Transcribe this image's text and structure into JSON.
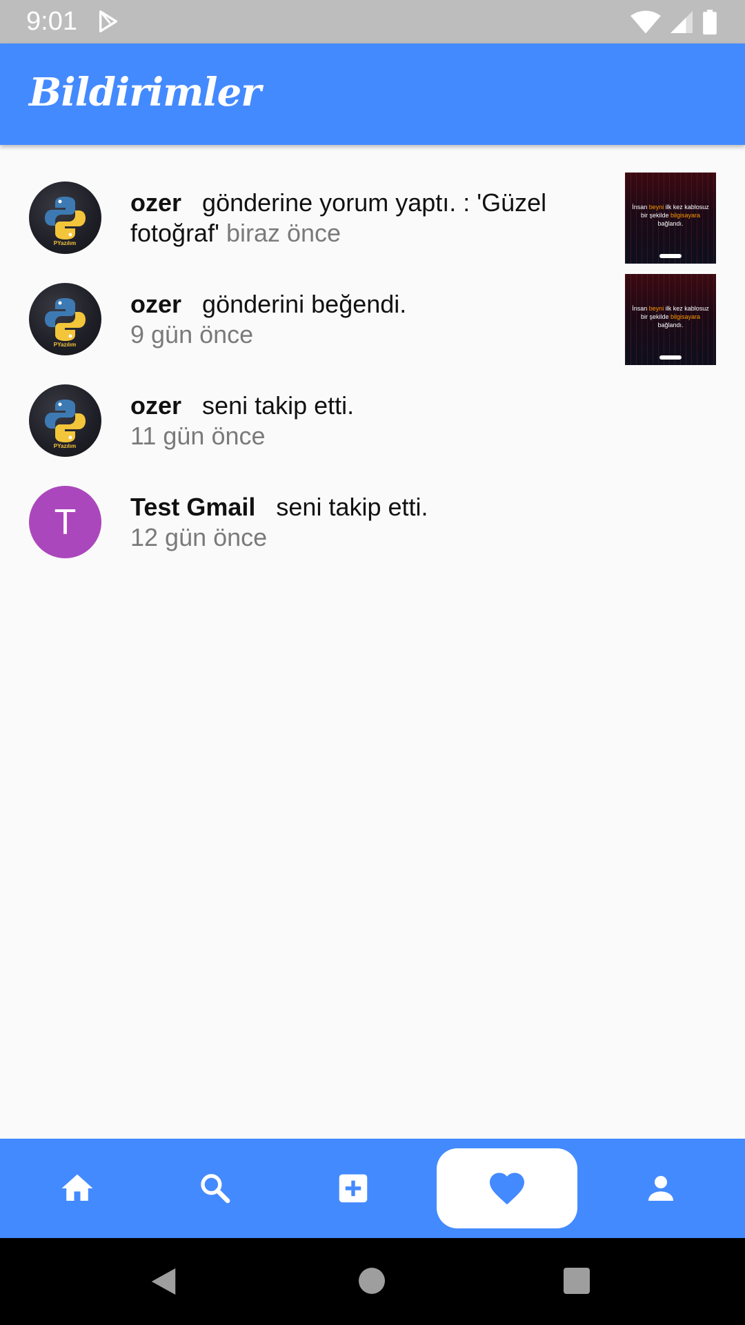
{
  "status_bar": {
    "time": "9:01"
  },
  "app_bar": {
    "title": "Bildirimler"
  },
  "notifications": [
    {
      "user": "ozer",
      "message": "gönderine yorum yaptı. : 'Güzel fotoğraf'",
      "time": "biraz önce",
      "avatar": "python-logo",
      "has_thumbnail": true
    },
    {
      "user": "ozer",
      "message": "gönderini beğendi.",
      "time": "9 gün önce",
      "avatar": "python-logo",
      "has_thumbnail": true
    },
    {
      "user": "ozer",
      "message": "seni takip etti.",
      "time": "11 gün önce",
      "avatar": "python-logo",
      "has_thumbnail": false
    },
    {
      "user": "Test Gmail",
      "message": "seni takip etti.",
      "time": "12 gün önce",
      "avatar_letter": "T",
      "has_thumbnail": false
    }
  ],
  "thumbnail": {
    "line1a": "İnsan ",
    "line1b": "beyni",
    "line1c": " ilk kez kablosuz",
    "line2a": "bir şekilde ",
    "line2b": "bilgisayara",
    "line3": "bağlandı."
  },
  "bottom_nav": {
    "items": [
      "home-icon",
      "search-icon",
      "add-box-icon",
      "favorite-icon",
      "person-icon"
    ],
    "active": "favorite-icon"
  },
  "colors": {
    "primary": "#448aff",
    "avatar_letter_bg": "#ab47bc",
    "status_bar": "#bdbdbd"
  }
}
